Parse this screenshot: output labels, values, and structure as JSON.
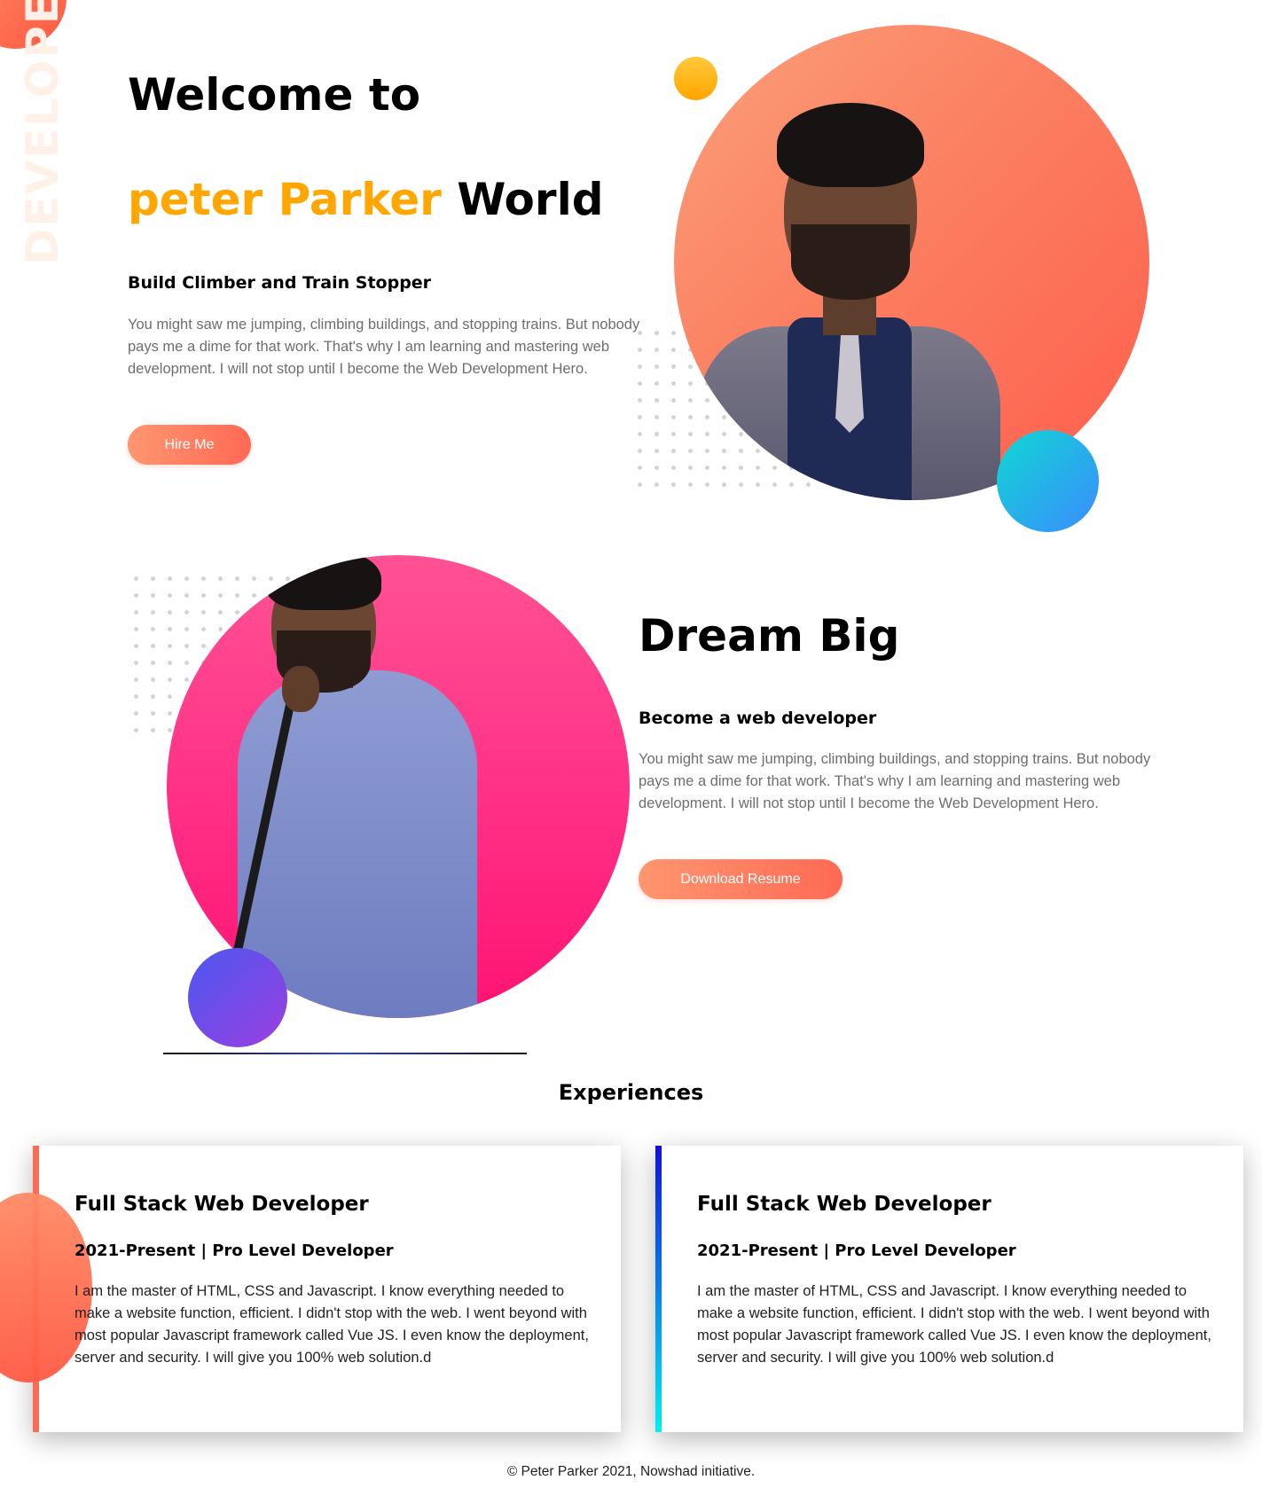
{
  "side_word": "DEVELOPER",
  "hero": {
    "title_line1": "Welcome to",
    "title_highlight": "peter Parker",
    "title_rest": "World",
    "subtitle": "Build Climber and Train Stopper",
    "text": "You might saw me jumping, climbing buildings, and stopping trains. But nobody pays me a dime for that work. That's why I am learning and mastering web development. I will not stop until I become the Web Development Hero.",
    "button_label": "Hire Me"
  },
  "dream": {
    "title": "Dream Big",
    "subtitle": "Become a web developer",
    "text": "You might saw me jumping, climbing buildings, and stopping trains. But nobody pays me a dime for that work. That's why I am learning and mastering web development. I will not stop until I become the Web Development Hero.",
    "button_label": "Download Resume"
  },
  "experiences": {
    "heading": "Experiences",
    "cards": [
      {
        "title": "Full Stack Web Developer",
        "period": "2021-Present | Pro Level Developer",
        "text": "I am the master of HTML, CSS and Javascript. I know everything needed to make a website function, efficient. I didn't stop with the web. I went beyond with most popular Javascript framework called Vue JS. I even know the deployment, server and security. I will give you 100% web solution.d"
      },
      {
        "title": "Full Stack Web Developer",
        "period": "2021-Present | Pro Level Developer",
        "text": "I am the master of HTML, CSS and Javascript. I know everything needed to make a website function, efficient. I didn't stop with the web. I went beyond with most popular Javascript framework called Vue JS. I even know the deployment, server and security. I will give you 100% web solution.d"
      }
    ]
  },
  "footer": {
    "text": "© Peter Parker 2021, Nowshad initiative."
  },
  "colors": {
    "accent_orange": "#ffa600",
    "button_gradient_start": "#ff9670",
    "button_gradient_end": "#ff6a55",
    "hero_circle": "#fb7f61",
    "dream_circle": "#ff2f86",
    "teal_accent": "#10d7d2",
    "purple_accent": "#7b4be8"
  }
}
